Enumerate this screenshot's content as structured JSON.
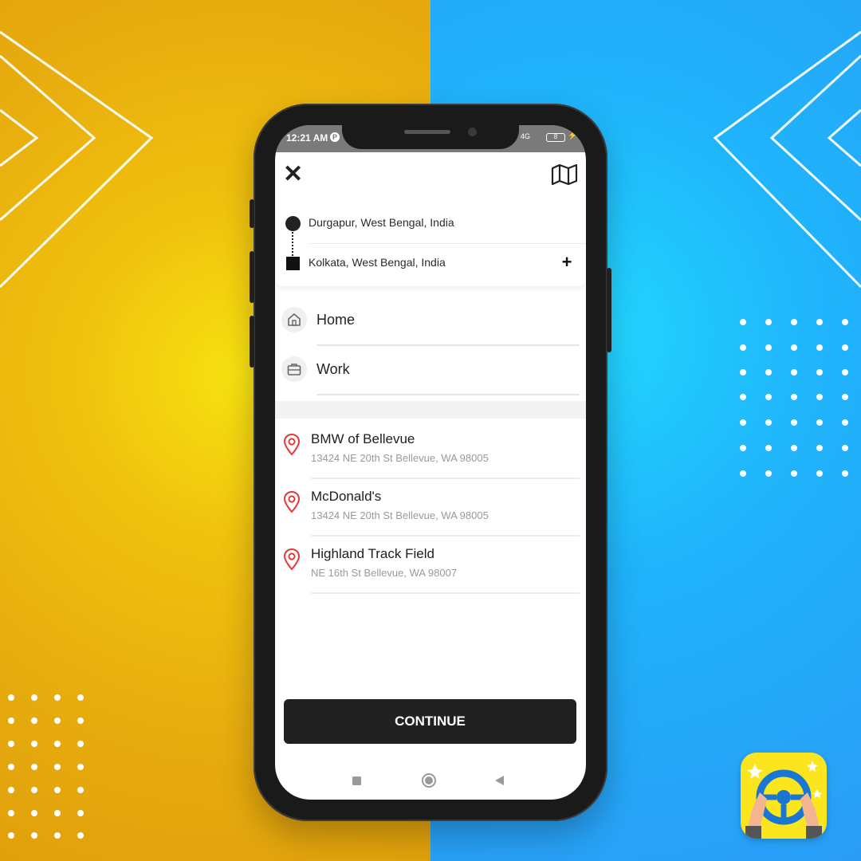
{
  "status_bar": {
    "time": "12:21 AM",
    "app_badge": "P",
    "network": "4G",
    "battery": "8"
  },
  "header": {
    "close_icon": "close-icon",
    "map_icon": "map-icon"
  },
  "route": {
    "origin": "Durgapur, West Bengal, India",
    "destination": "Kolkata, West Bengal, India",
    "add_stop_label": "+"
  },
  "saved_places": [
    {
      "label": "Home",
      "icon": "home-icon"
    },
    {
      "label": "Work",
      "icon": "briefcase-icon"
    }
  ],
  "suggestions": [
    {
      "name": "BMW of Bellevue",
      "address": "13424 NE 20th St Bellevue, WA 98005",
      "icon": "location-pin-icon"
    },
    {
      "name": "McDonald's",
      "address": "13424 NE 20th St Bellevue, WA 98005",
      "icon": "location-pin-icon"
    },
    {
      "name": "Highland Track Field",
      "address": "NE 16th St Bellevue, WA 98007",
      "icon": "location-pin-icon"
    }
  ],
  "continue_label": "CONTINUE",
  "colors": {
    "accent_pin": "#e53935",
    "button_bg": "#212121",
    "background_left": "#eab10e",
    "background_right": "#20a8fa"
  }
}
